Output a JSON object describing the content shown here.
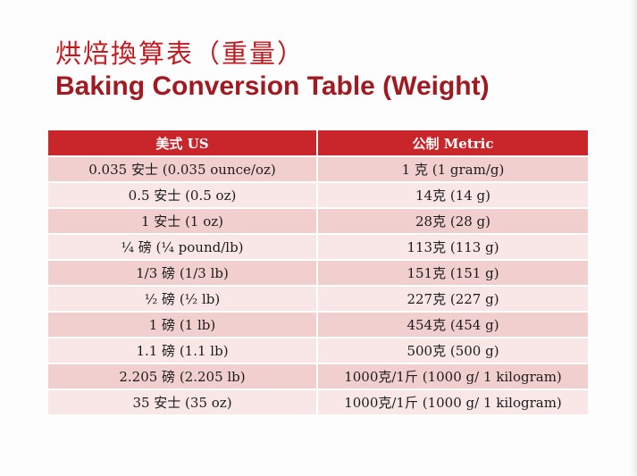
{
  "title_cn": "烘焙換算表（重量）",
  "title_en": "Baking Conversion Table (Weight)",
  "table": {
    "headers": [
      "美式 US",
      "公制 Metric"
    ],
    "rows": [
      [
        "0.035 安士 (0.035 ounce/oz)",
        "1 克 (1 gram/g)"
      ],
      [
        "0.5 安士 (0.5 oz)",
        "14克 (14 g)"
      ],
      [
        "1 安士 (1 oz)",
        "28克 (28 g)"
      ],
      [
        "¼ 磅 (¼ pound/lb)",
        "113克 (113 g)"
      ],
      [
        "1/3 磅 (1/3 lb)",
        "151克 (151 g)"
      ],
      [
        "½ 磅 (½ lb)",
        "227克 (227 g)"
      ],
      [
        "1 磅 (1 lb)",
        "454克 (454 g)"
      ],
      [
        "1.1 磅 (1.1 lb)",
        "500克 (500 g)"
      ],
      [
        "2.205 磅 (2.205 lb)",
        "1000克/1斤 (1000 g/ 1 kilogram)"
      ],
      [
        "35 安士 (35 oz)",
        "1000克/1斤 (1000 g/ 1 kilogram)"
      ]
    ]
  },
  "colors": {
    "title": "#c0191f",
    "header_bg": "#c8262a",
    "row_dark": "#f2cfcf",
    "row_light": "#f9e7e7"
  }
}
